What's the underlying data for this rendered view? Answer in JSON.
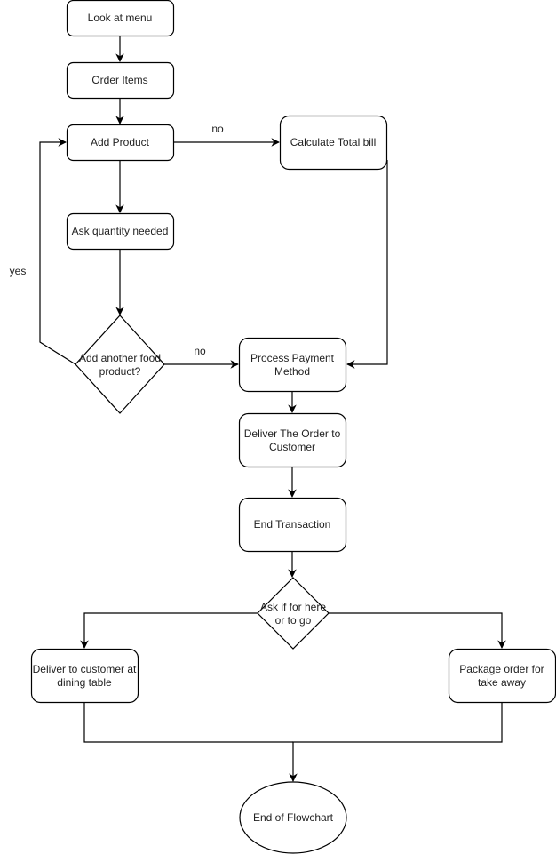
{
  "diagram": {
    "type": "flowchart",
    "nodes": [
      {
        "id": "look_menu",
        "shape": "rounded-rect",
        "lines": [
          "Look at menu"
        ]
      },
      {
        "id": "order_items",
        "shape": "rounded-rect",
        "lines": [
          "Order Items"
        ]
      },
      {
        "id": "add_product",
        "shape": "rounded-rect",
        "lines": [
          "Add Product"
        ]
      },
      {
        "id": "calc_bill",
        "shape": "rounded-rect",
        "lines": [
          "Calculate Total bill"
        ]
      },
      {
        "id": "ask_qty",
        "shape": "rounded-rect",
        "lines": [
          "Ask quantity needed"
        ]
      },
      {
        "id": "another_food",
        "shape": "diamond",
        "lines": [
          "Add another food",
          "product?"
        ]
      },
      {
        "id": "process_payment",
        "shape": "rounded-rect",
        "lines": [
          "Process Payment",
          "Method"
        ]
      },
      {
        "id": "deliver_order",
        "shape": "rounded-rect",
        "lines": [
          "Deliver The Order to",
          "Customer"
        ]
      },
      {
        "id": "end_transaction",
        "shape": "rounded-rect",
        "lines": [
          "End Transaction"
        ]
      },
      {
        "id": "here_or_go",
        "shape": "diamond",
        "lines": [
          "Ask if for here",
          "or to go"
        ]
      },
      {
        "id": "deliver_table",
        "shape": "rounded-rect",
        "lines": [
          "Deliver to customer at",
          "dining table"
        ]
      },
      {
        "id": "package_takeaway",
        "shape": "rounded-rect",
        "lines": [
          "Package order for",
          "take away"
        ]
      },
      {
        "id": "end_flowchart",
        "shape": "ellipse",
        "lines": [
          "End of Flowchart"
        ]
      }
    ],
    "edges": [
      {
        "from": "look_menu",
        "to": "order_items",
        "label": ""
      },
      {
        "from": "order_items",
        "to": "add_product",
        "label": ""
      },
      {
        "from": "add_product",
        "to": "calc_bill",
        "label": "no"
      },
      {
        "from": "add_product",
        "to": "ask_qty",
        "label": ""
      },
      {
        "from": "ask_qty",
        "to": "another_food",
        "label": ""
      },
      {
        "from": "another_food",
        "to": "add_product",
        "label": "yes"
      },
      {
        "from": "another_food",
        "to": "process_payment",
        "label": "no"
      },
      {
        "from": "calc_bill",
        "to": "process_payment",
        "label": ""
      },
      {
        "from": "process_payment",
        "to": "deliver_order",
        "label": ""
      },
      {
        "from": "deliver_order",
        "to": "end_transaction",
        "label": ""
      },
      {
        "from": "end_transaction",
        "to": "here_or_go",
        "label": ""
      },
      {
        "from": "here_or_go",
        "to": "deliver_table",
        "label": ""
      },
      {
        "from": "here_or_go",
        "to": "package_takeaway",
        "label": ""
      },
      {
        "from": "deliver_table",
        "to": "end_flowchart",
        "label": ""
      },
      {
        "from": "package_takeaway",
        "to": "end_flowchart",
        "label": ""
      }
    ]
  }
}
